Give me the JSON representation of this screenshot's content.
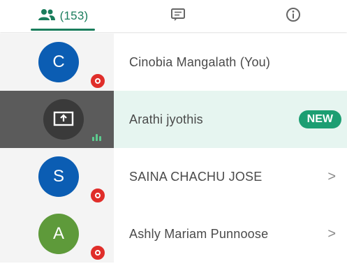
{
  "tabs": {
    "people": {
      "icon": "people-icon",
      "count": "(153)"
    },
    "chat": {
      "icon": "chat-icon"
    },
    "info": {
      "icon": "info-icon"
    }
  },
  "participants": [
    {
      "initial": "C",
      "name": "Cinobia Mangalath (You)",
      "avatar_color": "#0b5db3",
      "status_icon": "mic-muted-badge"
    },
    {
      "name": "Arathi jyothis",
      "tag": "NEW",
      "avatar_icon": "screen-share-icon",
      "status_icon": "speaking-icon"
    },
    {
      "initial": "S",
      "name": "SAINA CHACHU JOSE",
      "avatar_color": "#0b5db3",
      "status_icon": "mic-muted-badge",
      "chevron": ">"
    },
    {
      "initial": "A",
      "name": "Ashly Mariam Punnoose",
      "avatar_color": "#5e9a3a",
      "status_icon": "mic-muted-badge",
      "chevron": ">"
    }
  ],
  "colors": {
    "accent": "#1a7d5c",
    "new_badge": "#1c9e72",
    "muted": "#e02e2a"
  }
}
